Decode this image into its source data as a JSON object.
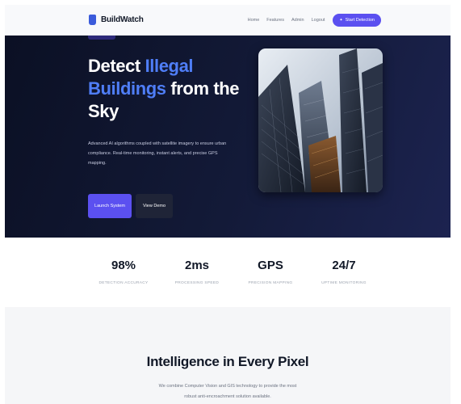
{
  "nav": {
    "logo": "BuildWatch",
    "links": [
      "Home",
      "Features",
      "Admin",
      "Logout"
    ],
    "cta": "Start Detection"
  },
  "hero": {
    "title_line1": "Detect ",
    "title_highlight_1": "Illegal",
    "title_highlight_2": "Buildings",
    "title_line2_rest": " from the",
    "title_line3": "Sky",
    "description": "Advanced AI algorithms coupled with satellite imagery to ensure urban compliance. Real-time monitoring, instant alerts, and precise GPS mapping.",
    "primary_button": "Launch System",
    "secondary_button": "View Demo"
  },
  "stats": [
    {
      "value": "98%",
      "label": "DETECTION ACCURACY"
    },
    {
      "value": "2ms",
      "label": "PROCESSING SPEED"
    },
    {
      "value": "GPS",
      "label": "PRECISION MAPPING"
    },
    {
      "value": "24/7",
      "label": "UPTIME MONITORING"
    }
  ],
  "features": {
    "title": "Intelligence in Every Pixel",
    "subtitle": "We combine Computer Vision and GIS technology to provide the most robust anti-encroachment solution available."
  },
  "colors": {
    "accent": "#5b50f0",
    "highlight": "#4f7ef7",
    "hero_bg": "#0b1024"
  }
}
